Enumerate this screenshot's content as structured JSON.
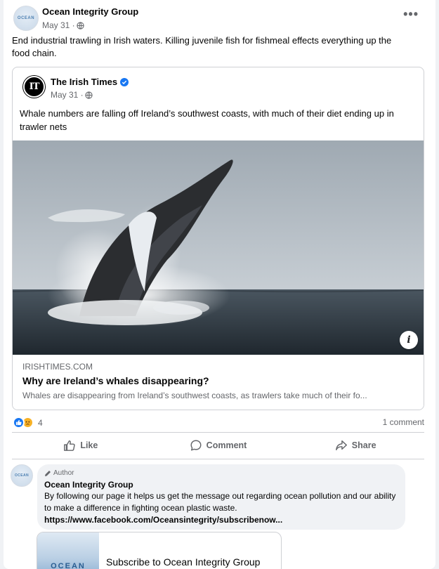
{
  "post": {
    "author": "Ocean Integrity Group",
    "avatar_text": "OCEAN",
    "date": "May 31 ·",
    "more_label": "•••",
    "text": "End industrial trawling in Irish waters. Killing juvenile fish for fishmeal effects everything up the food chain."
  },
  "shared": {
    "avatar_text": "IT",
    "author": "The Irish Times",
    "date": "May 31 ·",
    "text": "Whale numbers are falling off Ireland’s southwest coasts, with much of their diet ending up in trawler nets",
    "info_label": "i",
    "link": {
      "domain": "IRISHTIMES.COM",
      "title": "Why are Ireland’s whales disappearing?",
      "description": "Whales are disappearing from Ireland’s southwest coasts, as trawlers take much of their fo..."
    }
  },
  "stats": {
    "reaction_count": "4",
    "comment_count": "1 comment"
  },
  "actions": {
    "like": "Like",
    "comment": "Comment",
    "share": "Share"
  },
  "comment": {
    "avatar_text": "OCEAN",
    "badge": "Author",
    "author": "Ocean Integrity Group",
    "text": "By following our page it helps us get the message out regarding ocean pollution and our ability to make a difference in fighting ocean plastic waste. ",
    "link": "https://www.facebook.com/Oceansintegrity/subscribenow...",
    "card_logo": "OCEAN",
    "card_title": "Subscribe to Ocean Integrity Group"
  },
  "colors": {
    "accent": "#1877f2",
    "secondary_text": "#65676b",
    "divider": "#ced0d4"
  }
}
